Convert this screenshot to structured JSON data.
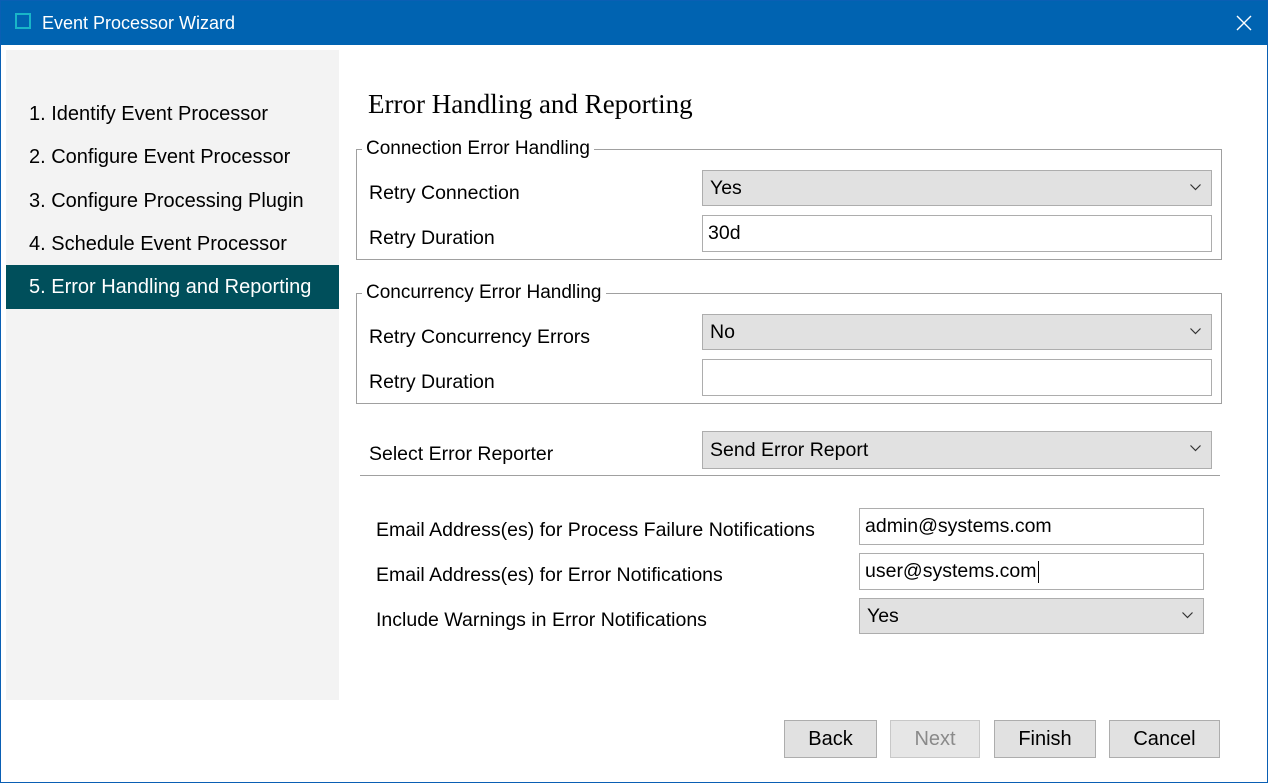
{
  "window": {
    "title": "Event Processor Wizard"
  },
  "steps": [
    {
      "label": "1. Identify Event Processor"
    },
    {
      "label": "2. Configure Event Processor"
    },
    {
      "label": "3. Configure Processing Plugin"
    },
    {
      "label": "4. Schedule Event Processor"
    },
    {
      "label": "5. Error Handling and Reporting",
      "active": true
    }
  ],
  "page": {
    "title": "Error Handling and Reporting"
  },
  "connection": {
    "legend": "Connection Error Handling",
    "retry_label": "Retry Connection",
    "retry_value": "Yes",
    "duration_label": "Retry Duration",
    "duration_value": "30d"
  },
  "concurrency": {
    "legend": "Concurrency Error Handling",
    "retry_label": "Retry Concurrency Errors",
    "retry_value": "No",
    "duration_label": "Retry Duration",
    "duration_value": ""
  },
  "reporter": {
    "label": "Select Error Reporter",
    "value": "Send Error Report"
  },
  "notifications": {
    "failure_label": "Email Address(es) for Process Failure Notifications",
    "failure_value": "admin@systems.com",
    "error_label": "Email Address(es) for Error Notifications",
    "error_value": "user@systems.com",
    "warnings_label": "Include Warnings in Error Notifications",
    "warnings_value": "Yes"
  },
  "buttons": {
    "back": "Back",
    "next": "Next",
    "finish": "Finish",
    "cancel": "Cancel"
  },
  "colors": {
    "titlebar": "#0063b1",
    "active_step": "#004f5b",
    "sidebar": "#f3f3f3"
  }
}
